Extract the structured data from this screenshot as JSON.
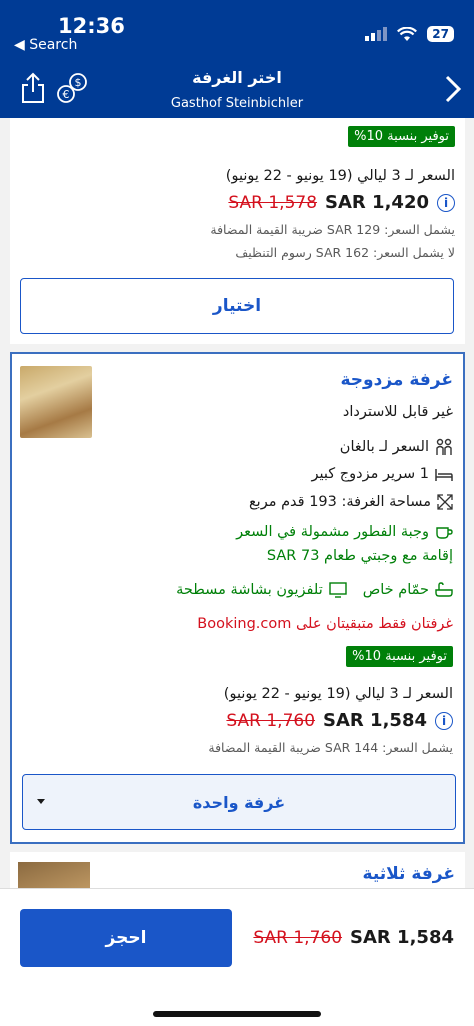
{
  "status_bar": {
    "time": "12:36",
    "back": "◀ Search",
    "battery": "27"
  },
  "header": {
    "title": "اختر الغرفة",
    "subtitle": "Gasthof Steinbichler"
  },
  "icons": [
    "share-icon",
    "currency-icon",
    "chevron-right-icon",
    "info-icon",
    "persons-icon",
    "bed-icon",
    "size-icon",
    "breakfast-icon",
    "tv-icon",
    "bath-icon"
  ],
  "colors": {
    "brand": "#003b95",
    "accent": "#1a56c8",
    "discount": "#008009",
    "strike": "#d4111e"
  },
  "room1": {
    "badge": "توفير بنسبة 10%",
    "stay": "السعر لـ 3 ليالي (19 يونيو - 22 يونيو)",
    "price_old": "SAR 1,578",
    "price_new": "SAR 1,420",
    "vat_note": "يشمل السعر: SAR 129 ضريبة القيمة المضافة",
    "cleaning_note": "لا يشمل السعر: SAR 162 رسوم التنظيف",
    "select_label": "اختيار"
  },
  "room2": {
    "title": "غرفة مزدوجة",
    "refund": "غير قابل للاسترداد",
    "persons": "السعر لـ بالغان",
    "bed": "1 سرير مزدوج كبير",
    "size": "مساحة الغرفة: 193 قدم مربع",
    "breakfast": "وجبة الفطور مشمولة في السعر",
    "halfboard": "إقامة مع وجبتي طعام SAR 73",
    "bath": "حمّام خاص",
    "tv": "تلفزيون بشاشة مسطحة",
    "scarcity": "غرفتان فقط متبقيتان على Booking.com",
    "badge": "توفير بنسبة 10%",
    "stay": "السعر لـ 3 ليالي (19 يونيو - 22 يونيو)",
    "price_old": "SAR 1,760",
    "price_new": "SAR 1,584",
    "vat_note": "يشمل السعر: SAR 144 ضريبة القيمة المضافة",
    "quantity": "غرفة واحدة"
  },
  "room3": {
    "title": "غرفة ثلاثية"
  },
  "footer": {
    "book_label": "احجز",
    "price_old": "SAR 1,760",
    "price_new": "SAR 1,584"
  }
}
